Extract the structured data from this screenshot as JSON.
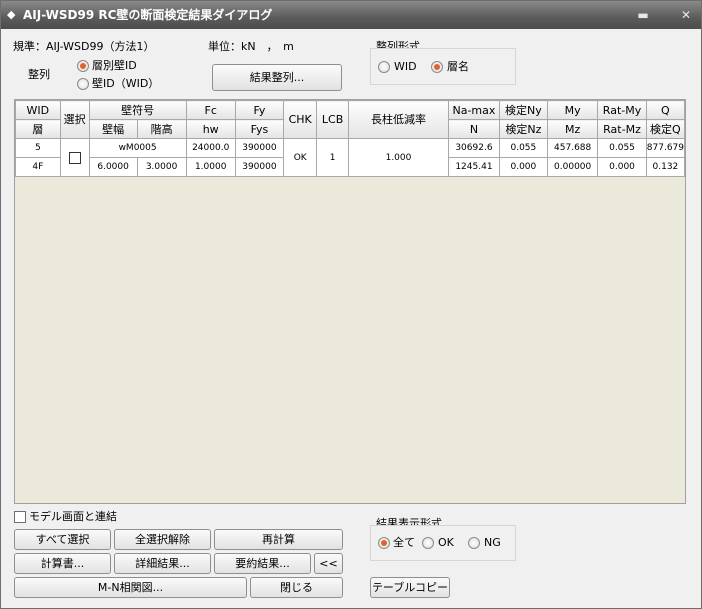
{
  "window": {
    "title": "AIJ-WSD99 RC壁の断面検定結果ダイアログ"
  },
  "top": {
    "standard": "規準：AIJ-WSD99（方法1）",
    "unit_label": "単位：kN　，　m",
    "sort_label": "整列",
    "sort_options": [
      "層別壁ID",
      "壁ID（WID）"
    ],
    "sort_selected": 0,
    "sort_button": "結果整列..."
  },
  "sort_format": {
    "title": "整列形式",
    "options": [
      "WID",
      "層名"
    ],
    "selected": 1
  },
  "table": {
    "header1": [
      "WID",
      "選択",
      "壁符号",
      "Fc",
      "Fy",
      "CHK",
      "LCB",
      "長柱低減率",
      "Na-max",
      "検定Ny",
      "My",
      "Rat-My",
      "Q"
    ],
    "header2": [
      "層",
      "壁幅",
      "階高",
      "hw",
      "Fys",
      "N",
      "検定Nz",
      "Mz",
      "Rat-Mz",
      "検定Q"
    ],
    "rows": [
      {
        "wid": "5",
        "layer": "4F",
        "selected": false,
        "mark": "wM0005",
        "width": "6.0000",
        "height": "3.0000",
        "fc": "24000.0",
        "hw": "1.0000",
        "fy": "390000",
        "fys": "390000",
        "chk": "OK",
        "lcb": "1",
        "reduction": "1.000",
        "na_max": "30692.6",
        "n": "1245.41",
        "ny": "0.055",
        "nz": "0.000",
        "my": "457.688",
        "mz": "0.00000",
        "rat_my": "0.055",
        "rat_mz": "0.000",
        "q": "877.679",
        "q_check": "0.132"
      }
    ]
  },
  "bottom": {
    "link_label": "モデル画面と連結",
    "link_checked": false,
    "buttons": {
      "select_all": "すべて選択",
      "deselect_all": "全選択解除",
      "recalc": "再計算",
      "report": "計算書...",
      "detail": "詳細結果...",
      "summary": "要約結果...",
      "collapse": "<<",
      "mn": "M-N相関図...",
      "close": "閉じる",
      "copy": "テーブルコピー"
    },
    "display": {
      "title": "結果表示形式",
      "options": [
        "全て",
        "OK",
        "NG"
      ],
      "selected": 0
    }
  }
}
